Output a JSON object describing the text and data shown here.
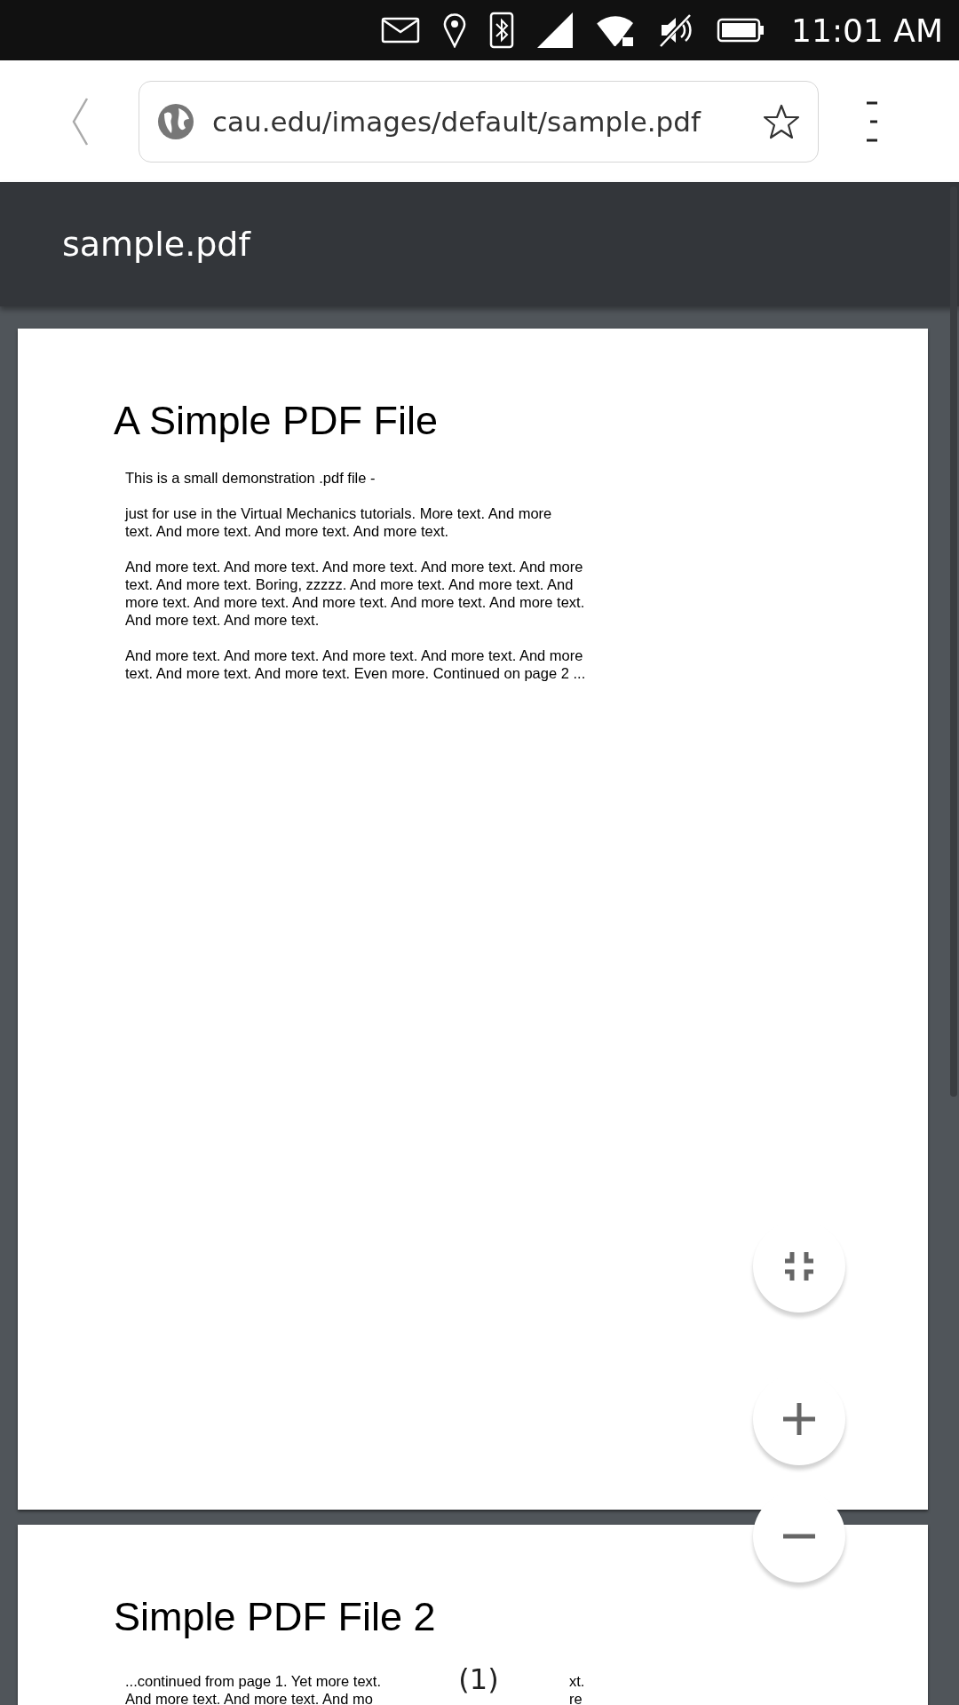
{
  "status_bar": {
    "time": "11:01 AM"
  },
  "address_bar": {
    "url": "cau.edu/images/default/sample.pdf",
    "bookmarked": false
  },
  "viewer": {
    "title": "sample.pdf",
    "page_indicator": "(1)"
  },
  "pages": [
    {
      "heading": "A Simple PDF File",
      "paragraphs": [
        "This is a small demonstration .pdf file -",
        "just for use in the Virtual Mechanics tutorials. More text. And more\ntext. And more text. And more text. And more text.",
        "And more text. And more text. And more text. And more text. And more\ntext. And more text. Boring, zzzzz. And more text. And more text. And\nmore text. And more text. And more text. And more text. And more text.\nAnd more text. And more text.",
        "And more text. And more text. And more text. And more text. And more\ntext. And more text. And more text. Even more. Continued on page 2 ..."
      ]
    },
    {
      "heading": "Simple PDF File 2",
      "partial_lines": [
        {
          "left": "...continued from page 1. Yet more text.",
          "right": "xt."
        },
        {
          "left": "And more text. And more text. And mo",
          "right": "re"
        }
      ]
    }
  ]
}
